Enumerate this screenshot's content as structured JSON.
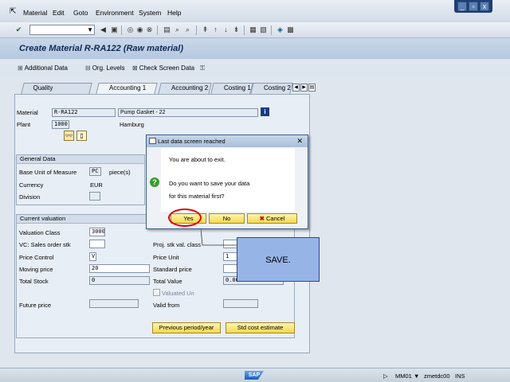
{
  "menu": {
    "items": [
      "Material",
      "Edit",
      "Goto",
      "Environment",
      "System",
      "Help"
    ]
  },
  "window_controls": [
    "_",
    "▫",
    "x"
  ],
  "title": "Create Material R-RA122 (Raw material)",
  "app_toolbar": {
    "additional_data": "Additional Data",
    "org_levels": "Org. Levels",
    "check_screen_data": "Check Screen Data"
  },
  "tabs": [
    "Quality management",
    "Accounting 1",
    "Accounting 2",
    "Costing 1",
    "Costing 2"
  ],
  "header": {
    "material_label": "Material",
    "material_value": "R-RA122",
    "material_desc": "Pump Gasket - 22",
    "plant_label": "Plant",
    "plant_value": "1000",
    "plant_name": "Hamburg"
  },
  "general_data": {
    "title": "General Data",
    "base_uom_label": "Base Unit of Measure",
    "base_uom_value": "PC",
    "base_uom_text": "piece(s)",
    "currency_label": "Currency",
    "currency_value": "EUR",
    "division_label": "Division"
  },
  "current_valuation": {
    "title": "Current valuation",
    "valuation_class_label": "Valuation Class",
    "valuation_class_value": "3000",
    "vc_sales_label": "VC: Sales order stk",
    "proj_stk_label": "Proj. stk val. class",
    "price_control_label": "Price Control",
    "price_control_value": "V",
    "price_unit_label": "Price Unit",
    "price_unit_value": "1",
    "moving_price_label": "Moving price",
    "moving_price_value": "20",
    "standard_price_label": "Standard price",
    "total_stock_label": "Total Stock",
    "total_stock_value": "0",
    "total_value_label": "Total Value",
    "total_value_value": "0.00",
    "valuated_un_label": "Valuated Un",
    "future_price_label": "Future price",
    "valid_from_label": "Valid from",
    "prev_period_button": "Previous period/year",
    "std_cost_button": "Std cost estimate"
  },
  "dialog": {
    "title": "Last data screen reached",
    "line1": "You are about to exit.",
    "line2": "Do you want to save your data",
    "line3": "for this material first?",
    "yes": "Yes",
    "no": "No",
    "cancel": "Cancel"
  },
  "callout": "SAVE.",
  "status": {
    "system": "MM01",
    "server": "zmetdc00",
    "mode": "INS"
  }
}
